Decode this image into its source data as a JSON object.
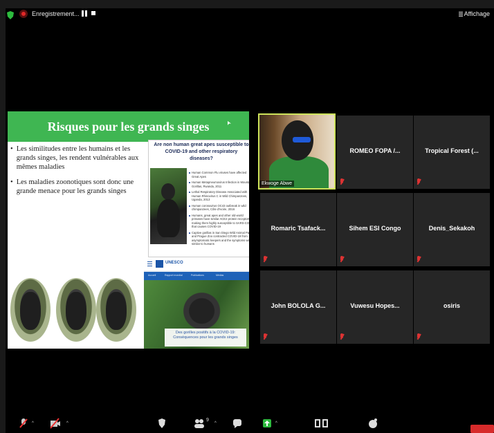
{
  "window": {
    "background": "#000000"
  },
  "recording": {
    "label": "Enregistrement...",
    "dot_color": "#e02828"
  },
  "view_button": {
    "label": "Affichage"
  },
  "slide": {
    "title": "Risques pour les grands singes",
    "title_bg": "#3fb652",
    "bullets": [
      "Les similitudes entre les humains et les grands singes, les rendent vulnérables aux mêmes maladies",
      "Les maladies zoonotiques sont donc une grande menace pour les grands singes"
    ],
    "article": {
      "question": "Are non human great apes susceptible to COVID-19 and other respiratory diseases?",
      "items": [
        "Human Common Flu viruses have affected Great Apes",
        "Human Metapneumovirus Infection in Mountain Gorillas, Rwanda, 2011",
        "Lethal Respiratory Disease Associated with Human Rhinovirus C in Wild Chimpanzees, Uganda, 2013",
        "Human coronavirus OC43 outbreak in wild chimpanzees, Côte d'Ivoire, 2016",
        "Humans, great apes and other old-world primates have similar ACE2 protein receptors making them highly susceptible to SARS-COV2 that causes COVID-19",
        "Captive gorillas in San Diego Wild Animal Park and Prague Zoo contracted COVID-19 from asymptomatic keepers and the symptoms were similar to humans"
      ]
    },
    "unesco": {
      "name": "UNESCO",
      "nav": [
        "Accueil",
        "Rapport mondial",
        "Publications",
        "Médias"
      ],
      "caption": "Des gorilles positifs à la COVID-19: Conséquences pour les grands singes"
    }
  },
  "participants": {
    "video": {
      "name": "Ekwoge Abwe"
    },
    "tiles": [
      "ROMEO FOPA /...",
      "Tropical Forest (...",
      "Romaric Tsafack...",
      "Sihem ESI Congo",
      "Denis_Sekakoh",
      "John BOLOLA G...",
      "Vuwesu Hopes...",
      "osiris"
    ]
  },
  "toolbar": {
    "participants_count": "9",
    "share_color": "#2dbb3e",
    "end_color": "#d72b2b"
  }
}
